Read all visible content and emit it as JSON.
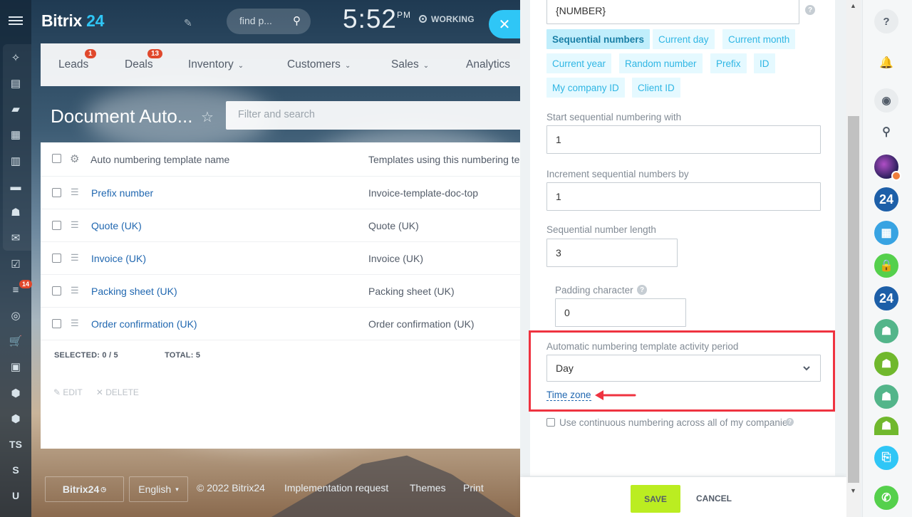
{
  "header": {
    "logo_text": "Bitrix",
    "logo_num": "24",
    "search_placeholder": "find p...",
    "time": "5:52",
    "ampm": "PM",
    "status": "WORKING"
  },
  "nav": {
    "items": [
      {
        "label": "Leads",
        "badge": "1"
      },
      {
        "label": "Deals",
        "badge": "13"
      },
      {
        "label": "Inventory"
      },
      {
        "label": "Customers"
      },
      {
        "label": "Sales"
      },
      {
        "label": "Analytics"
      }
    ]
  },
  "left_bar": {
    "badge": "14",
    "text_items": [
      "TS",
      "S",
      "U"
    ]
  },
  "page": {
    "title": "Document Auto...",
    "filter_placeholder": "Filter and search"
  },
  "grid": {
    "col1": "Auto numbering template name",
    "col2": "Templates using this numbering te",
    "rows": [
      {
        "name": "Prefix number",
        "templates": "Invoice-template-doc-top"
      },
      {
        "name": "Quote (UK)",
        "templates": "Quote (UK)"
      },
      {
        "name": "Invoice (UK)",
        "templates": "Invoice (UK)"
      },
      {
        "name": "Packing sheet (UK)",
        "templates": "Packing sheet (UK)"
      },
      {
        "name": "Order confirmation (UK)",
        "templates": "Order confirmation (UK)"
      }
    ],
    "selected_label": "SELECTED:",
    "selected_value": "0 / 5",
    "total_label": "TOTAL:",
    "total_value": "5",
    "edit_label": "EDIT",
    "delete_label": "DELETE"
  },
  "footer": {
    "brand": "Bitrix24",
    "language": "English",
    "copyright": "© 2022 Bitrix24",
    "link1": "Implementation request",
    "link2": "Themes",
    "link3": "Print"
  },
  "panel": {
    "template_value": "{NUMBER}",
    "tags": [
      "Sequential numbers",
      "Current day",
      "Current month",
      "Current year",
      "Random number",
      "Prefix",
      "ID",
      "My company ID",
      "Client ID"
    ],
    "start_label": "Start sequential numbering with",
    "start_value": "1",
    "increment_label": "Increment sequential numbers by",
    "increment_value": "1",
    "length_label": "Sequential number length",
    "length_value": "3",
    "padding_label": "Padding character",
    "padding_value": "0",
    "period_label": "Automatic numbering template activity period",
    "period_value": "Day",
    "timezone_link": "Time zone",
    "continuous_label": "Use continuous numbering across all of my companies",
    "continuous_checked": false,
    "save": "SAVE",
    "cancel": "CANCEL"
  },
  "right_bar": {
    "b24_text": "24"
  },
  "colors": {
    "accent": "#2fc6f6",
    "save_button": "#bbed21",
    "highlight_box": "#ef3340",
    "badge": "#e0482c"
  }
}
